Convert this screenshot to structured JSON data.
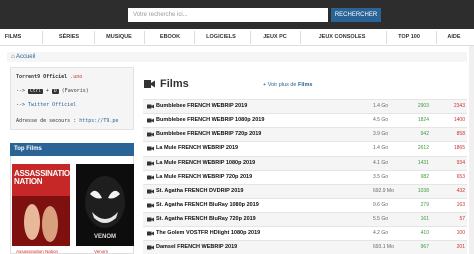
{
  "search": {
    "placeholder": "Votre recherche ici...",
    "button_label": "RECHERCHER"
  },
  "nav": [
    {
      "label": "FILMS"
    },
    {
      "label": "SÉRIES"
    },
    {
      "label": "MUSIQUE"
    },
    {
      "label": "EBOOK"
    },
    {
      "label": "LOGICIELS"
    },
    {
      "label": "JEUX PC"
    },
    {
      "label": "JEUX CONSOLES"
    },
    {
      "label": "TOP 100"
    },
    {
      "label": "AIDE"
    }
  ],
  "breadcrumb": {
    "label": "Accueil"
  },
  "info": {
    "site_name": "Torrent9 Officiel",
    "site_tld": ".uno",
    "line2_prefix": "-->",
    "key1": "Ctrl",
    "line2_plus": "+",
    "key2": "D",
    "line2_suffix": "(Favoris)",
    "line3_prefix": "-->",
    "twitter": "Twitter Officiel",
    "backup_label": "Adresse de secours :",
    "backup_url": "https://T9.pe"
  },
  "top_films": {
    "title": "Top Films",
    "posters": [
      {
        "title_art": "ASSASSINATION NATION",
        "caption": "Assassination Nation",
        "color": "#b71c1c"
      },
      {
        "title_art": "VENOM",
        "caption": "Venom",
        "color": "#111111"
      }
    ]
  },
  "films": {
    "heading": "Films",
    "voir_plus_prefix": "Voir plus de",
    "voir_plus_bold": "Films",
    "rows": [
      {
        "title": "Bumblebee FRENCH WEBRIP 2019",
        "size": "1.4 Go",
        "seeders": "2903",
        "leechers": "2343"
      },
      {
        "title": "Bumblebee FRENCH WEBRIP 1080p 2019",
        "size": "4.5 Go",
        "seeders": "1824",
        "leechers": "1400"
      },
      {
        "title": "Bumblebee FRENCH WEBRIP 720p 2019",
        "size": "3.9 Go",
        "seeders": "942",
        "leechers": "858"
      },
      {
        "title": "La Mule FRENCH WEBRIP 2019",
        "size": "1.4 Go",
        "seeders": "2612",
        "leechers": "1865"
      },
      {
        "title": "La Mule FRENCH WEBRIP 1080p 2019",
        "size": "4.1 Go",
        "seeders": "1431",
        "leechers": "934"
      },
      {
        "title": "La Mule FRENCH WEBRIP 720p 2019",
        "size": "3.5 Go",
        "seeders": "982",
        "leechers": "653"
      },
      {
        "title": "St. Agatha FRENCH DVDRIP 2019",
        "size": "692.9 Mo",
        "seeders": "1038",
        "leechers": "432"
      },
      {
        "title": "St. Agatha FRENCH BluRay 1080p 2019",
        "size": "9.6 Go",
        "seeders": "279",
        "leechers": "163"
      },
      {
        "title": "St. Agatha FRENCH BluRay 720p 2019",
        "size": "5.5 Go",
        "seeders": "161",
        "leechers": "57"
      },
      {
        "title": "The Golem VOSTFR HDlight 1080p 2019",
        "size": "4.2 Go",
        "seeders": "410",
        "leechers": "100"
      },
      {
        "title": "Damsel FRENCH WEBRIP 2019",
        "size": "693.1 Mo",
        "seeders": "967",
        "leechers": "201"
      }
    ]
  },
  "colors": {
    "topbar": "#2d2d2d",
    "accent": "#2a6496",
    "seeders": "#3c9b3c",
    "leechers": "#c9302c"
  },
  "icons": {
    "films_heading": "film-icon",
    "row": "camera-icon"
  }
}
